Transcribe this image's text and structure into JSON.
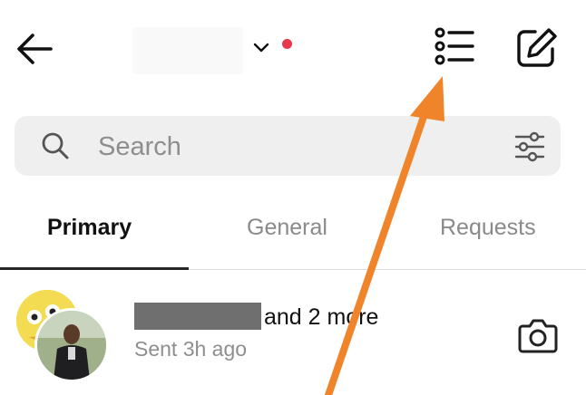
{
  "header": {
    "back_icon": "arrow-left-icon",
    "account_switch_icon": "chevron-down-icon",
    "notification_dot_color": "#e8364b",
    "list_icon": "list-icon",
    "compose_icon": "edit-icon"
  },
  "search": {
    "placeholder": "Search",
    "icon": "search-icon",
    "filter_icon": "sliders-icon"
  },
  "tabs": [
    {
      "label": "Primary",
      "active": true
    },
    {
      "label": "General",
      "active": false
    },
    {
      "label": "Requests",
      "active": false
    }
  ],
  "conversations": [
    {
      "title_suffix": "and 2 more",
      "subtitle": "Sent 3h ago",
      "action_icon": "camera-icon"
    }
  ],
  "annotation": {
    "arrow_color": "#f0842b",
    "points_to": "list-icon"
  }
}
